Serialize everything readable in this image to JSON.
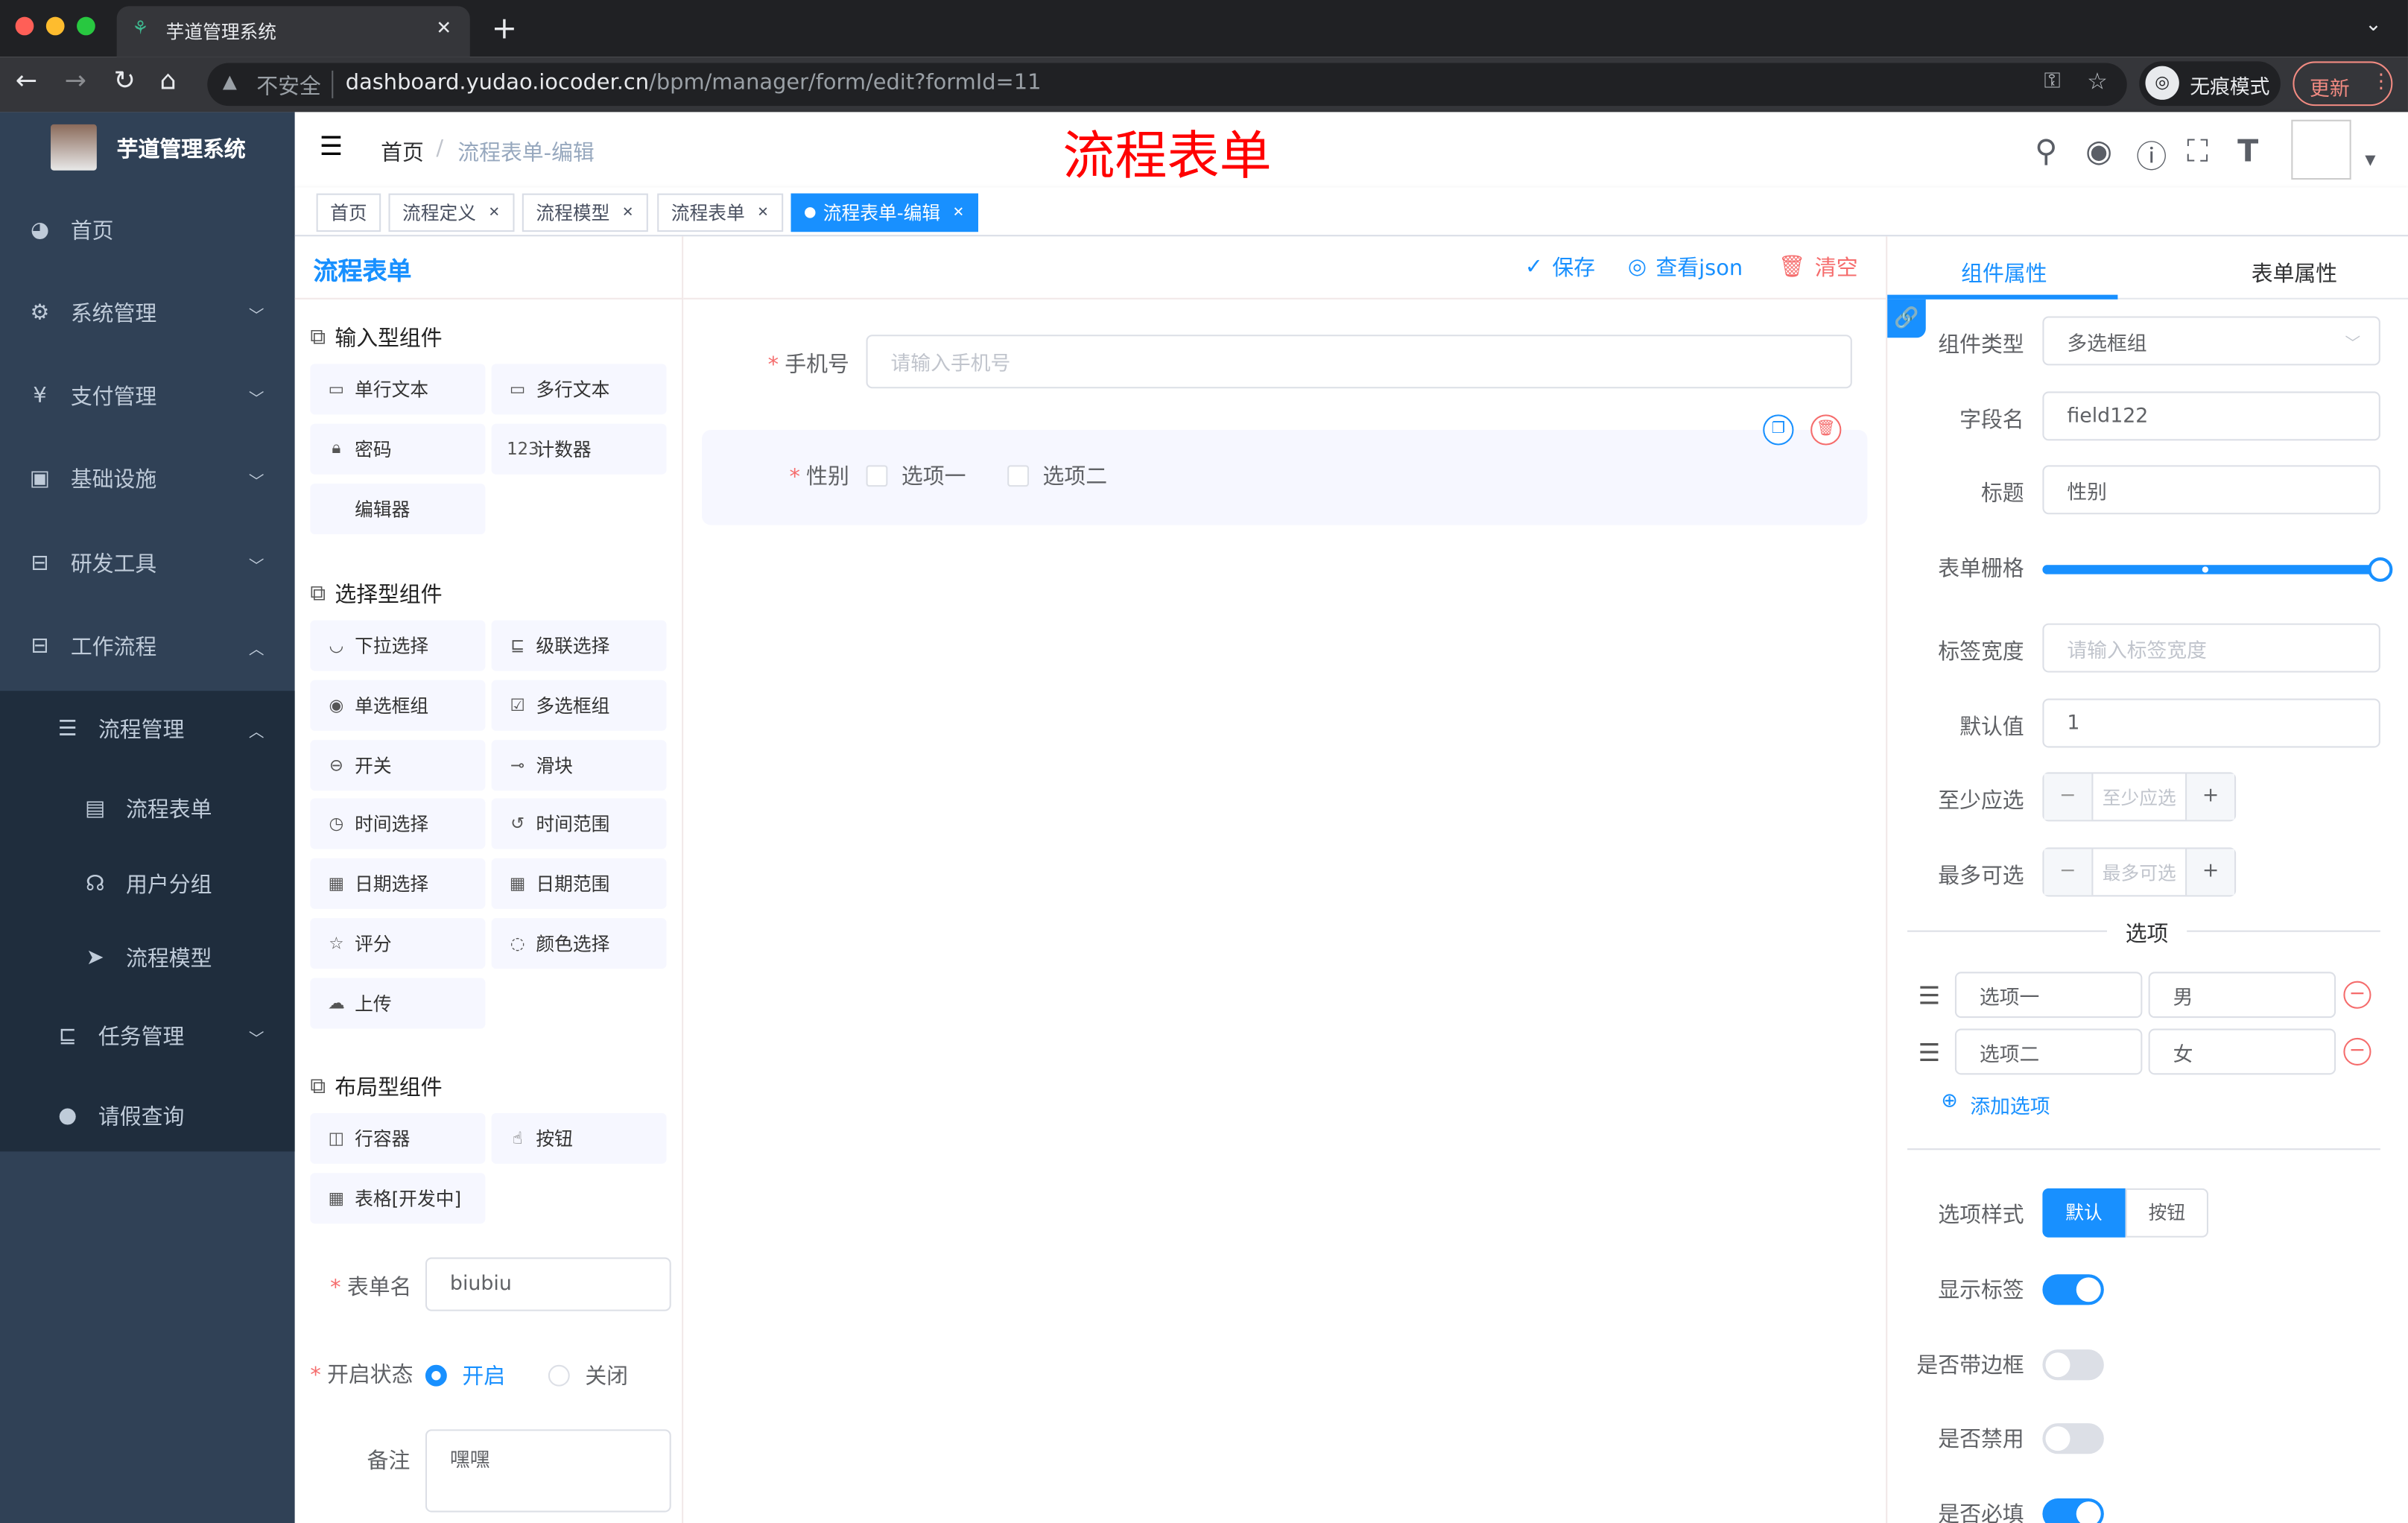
{
  "browser": {
    "tab_title": "芋道管理系统",
    "security": "不安全",
    "url_host": "dashboard.yudao.iocoder.cn",
    "url_path": "/bpm/manager/form/edit?formId=11",
    "incognito": "无痕模式",
    "update": "更新"
  },
  "sidebar": {
    "title": "芋道管理系统",
    "items": [
      {
        "label": "首页",
        "icon": "dashboard-icon"
      },
      {
        "label": "系统管理",
        "icon": "gear-icon"
      },
      {
        "label": "支付管理",
        "icon": "yen-icon"
      },
      {
        "label": "基础设施",
        "icon": "monitor-icon"
      },
      {
        "label": "研发工具",
        "icon": "toolbox-icon"
      },
      {
        "label": "工作流程",
        "icon": "toolbox-icon"
      },
      {
        "label": "流程管理",
        "icon": "tree-list-icon"
      },
      {
        "label": "流程表单",
        "icon": "form-icon"
      },
      {
        "label": "用户分组",
        "icon": "user-group-icon"
      },
      {
        "label": "流程模型",
        "icon": "send-icon"
      },
      {
        "label": "任务管理",
        "icon": "task-icon"
      },
      {
        "label": "请假查询",
        "icon": "user-icon"
      }
    ]
  },
  "header": {
    "breadcrumb": [
      "首页",
      "流程表单-编辑"
    ],
    "overlay_title": "流程表单"
  },
  "tags": [
    {
      "label": "首页"
    },
    {
      "label": "流程定义"
    },
    {
      "label": "流程模型"
    },
    {
      "label": "流程表单"
    },
    {
      "label": "流程表单-编辑"
    }
  ],
  "left": {
    "groups": [
      {
        "title": "输入型组件",
        "items": [
          "单行文本",
          "多行文本",
          "密码",
          "计数器",
          "编辑器"
        ]
      },
      {
        "title": "选择型组件",
        "items": [
          "下拉选择",
          "级联选择",
          "单选框组",
          "多选框组",
          "开关",
          "滑块",
          "时间选择",
          "时间范围",
          "日期选择",
          "日期范围",
          "评分",
          "颜色选择",
          "上传"
        ]
      },
      {
        "title": "布局型组件",
        "items": [
          "行容器",
          "按钮",
          "表格[开发中]"
        ]
      }
    ],
    "form_name_label": "表单名",
    "form_name": "biubiu",
    "status_label": "开启状态",
    "status_on": "开启",
    "status_off": "关闭",
    "status_value": "开启",
    "remark_label": "备注",
    "remark": "嘿嘿"
  },
  "center": {
    "title": "流程表单",
    "save": "保存",
    "view_json": "查看json",
    "clear": "清空",
    "fields": {
      "phone_label": "手机号",
      "phone_placeholder": "请输入手机号",
      "gender_label": "性别",
      "options": [
        "选项一",
        "选项二"
      ]
    }
  },
  "right": {
    "tabs": [
      "组件属性",
      "表单属性"
    ],
    "active_tab": "组件属性",
    "type_label": "组件类型",
    "type_value": "多选框组",
    "field_label": "字段名",
    "field_value": "field122",
    "title_label": "标题",
    "title_value": "性别",
    "grid_label": "表单栅格",
    "grid_value": 24,
    "grid_max": 24,
    "label_width_label": "标签宽度",
    "label_width_placeholder": "请输入标签宽度",
    "default_label": "默认值",
    "default_value": "1",
    "min_label": "至少应选",
    "min_placeholder": "至少应选",
    "max_label": "最多可选",
    "max_placeholder": "最多可选",
    "options_divider": "选项",
    "options": [
      {
        "label": "选项一",
        "value": "男"
      },
      {
        "label": "选项二",
        "value": "女"
      }
    ],
    "add_option": "添加选项",
    "style_label": "选项样式",
    "style_options": [
      "默认",
      "按钮"
    ],
    "style_value": "默认",
    "show_label": "显示标签",
    "show_label_on": true,
    "border_label": "是否带边框",
    "border_on": false,
    "disabled_label": "是否禁用",
    "disabled_on": false,
    "required_label": "是否必填",
    "required_on": true
  },
  "colors": {
    "primary": "#1890ff",
    "danger": "#f56c6c",
    "sidebar": "#304156",
    "title_red": "#ff0000"
  }
}
